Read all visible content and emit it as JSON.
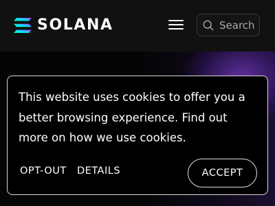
{
  "header": {
    "logo_text": "SOLANA",
    "logo_icon": "solana-logo-mark",
    "menu_icon": "hamburger-menu-icon",
    "search": {
      "icon": "search-icon",
      "placeholder": "Search"
    }
  },
  "cookie_banner": {
    "message": "This website uses cookies to offer you a better browsing experience. Find out more on how we use cookies.",
    "opt_out_label": "OPT-OUT",
    "details_label": "DETAILS",
    "accept_label": "ACCEPT"
  },
  "colors": {
    "header_bg": "#111111",
    "banner_bg": "#000000",
    "banner_border": "#d9d9d9",
    "text": "#ffffff",
    "logo_gradient": [
      "#00ffa3",
      "#03e1ff",
      "#dc1fff"
    ]
  }
}
